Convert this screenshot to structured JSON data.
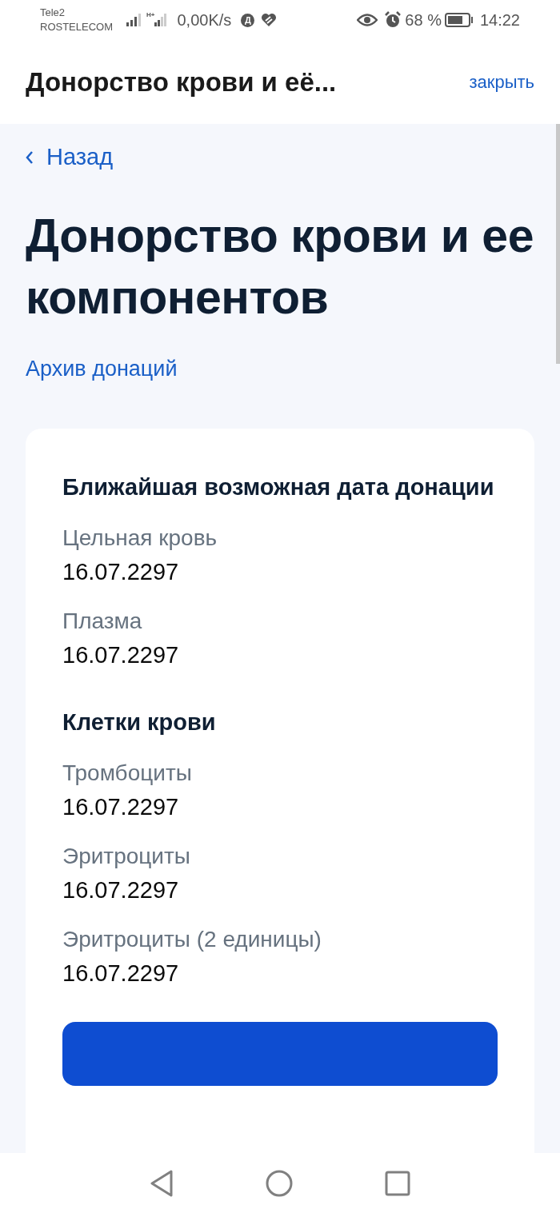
{
  "status_bar": {
    "carriers": [
      "Tele2",
      "ROSTELECOM"
    ],
    "network_type": "H+",
    "speed": "0,00K/s",
    "app_badge": "Д",
    "battery_percent": "68 %",
    "time": "14:22"
  },
  "header": {
    "title": "Донорство крови и её...",
    "close": "закрыть"
  },
  "back": "Назад",
  "title": "Донорство крови и ее компонентов",
  "archive_link": "Архив донаций",
  "card": {
    "title": "Ближайшая возможная дата донации",
    "sections": [
      {
        "kind": "list",
        "items": [
          {
            "label": "Цельная кровь",
            "date": "16.07.2297"
          },
          {
            "label": "Плазма",
            "date": "16.07.2297"
          }
        ]
      },
      {
        "kind": "heading",
        "text": "Клетки крови"
      },
      {
        "kind": "list",
        "items": [
          {
            "label": "Тромбоциты",
            "date": "16.07.2297"
          },
          {
            "label": "Эритроциты",
            "date": "16.07.2297"
          },
          {
            "label": "Эритроциты (2 единицы)",
            "date": "16.07.2297"
          }
        ]
      }
    ]
  }
}
